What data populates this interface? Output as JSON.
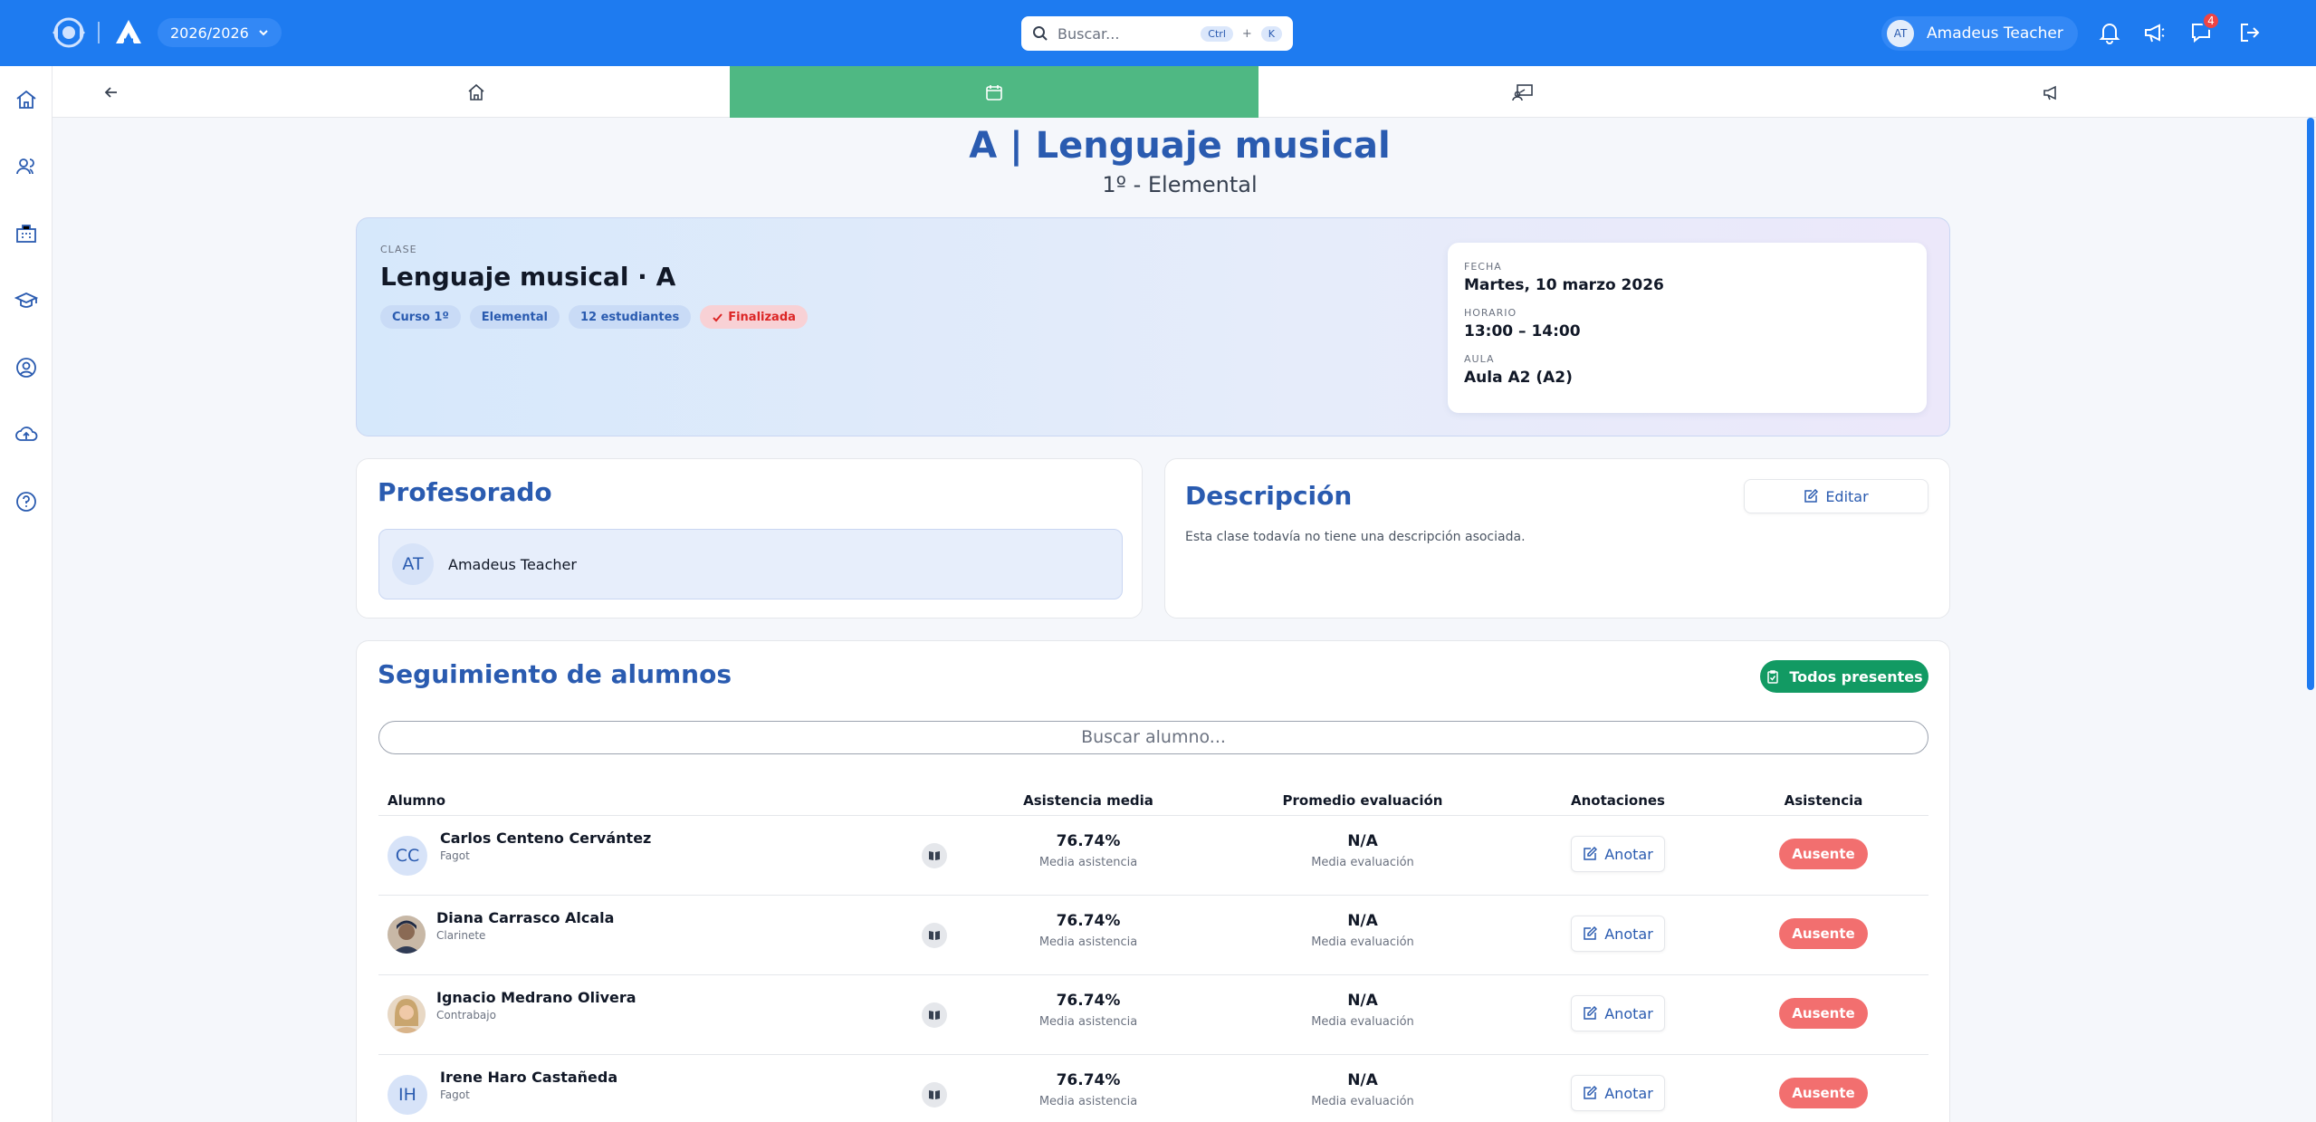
{
  "topbar": {
    "year": "2026/2026",
    "search_placeholder": "Buscar...",
    "kbd_ctrl": "Ctrl",
    "kbd_plus": "+",
    "kbd_k": "K",
    "user_initials": "AT",
    "user_name": "Amadeus Teacher",
    "messages_count": "4",
    "accent": "#1e7bf0"
  },
  "sidebar": {
    "items": [
      "home-icon",
      "users-icon",
      "building-icon",
      "graduation-cap-icon",
      "user-circle-icon",
      "cloud-upload-icon",
      "help-circle-icon"
    ]
  },
  "tabs": [
    "back-arrow-icon",
    "home-icon",
    "calendar-icon",
    "classroom-teacher-icon",
    "megaphone-icon"
  ],
  "header": {
    "title": "A | Lenguaje musical",
    "subtitle": "1º - Elemental"
  },
  "class_card": {
    "label": "CLASE",
    "name": "Lenguaje musical · A",
    "chips": [
      "Curso 1º",
      "Elemental",
      "12 estudiantes"
    ],
    "status": "Finalizada",
    "date_label": "FECHA",
    "date": "Martes, 10 marzo 2026",
    "time_label": "HORARIO",
    "time": "13:00 – 14:00",
    "room_label": "AULA",
    "room": "Aula A2 (A2)"
  },
  "teachers": {
    "title": "Profesorado",
    "items": [
      {
        "initials": "AT",
        "name": "Amadeus Teacher"
      }
    ]
  },
  "description": {
    "title": "Descripción",
    "edit_label": "Editar",
    "text": "Esta clase todavía no tiene una descripción asociada."
  },
  "students": {
    "title": "Seguimiento de alumnos",
    "all_present_label": "Todos presentes",
    "search_placeholder": "Buscar alumno...",
    "columns": [
      "Alumno",
      "Asistencia media",
      "Promedio evaluación",
      "Anotaciones",
      "Asistencia"
    ],
    "rows": [
      {
        "initials": "CC",
        "name": "Carlos Centeno Cervántez",
        "instrument": "Fagot",
        "attendance": "76.74%",
        "attendance_sub": "Media asistencia",
        "grade": "N/A",
        "grade_sub": "Media evaluación",
        "note_label": "Anotar",
        "status": "Ausente"
      },
      {
        "initials": "",
        "name": "Diana Carrasco Alcala",
        "instrument": "Clarinete",
        "attendance": "76.74%",
        "attendance_sub": "Media asistencia",
        "grade": "N/A",
        "grade_sub": "Media evaluación",
        "note_label": "Anotar",
        "status": "Ausente"
      },
      {
        "initials": "",
        "name": "Ignacio Medrano Olivera",
        "instrument": "Contrabajo",
        "attendance": "76.74%",
        "attendance_sub": "Media asistencia",
        "grade": "N/A",
        "grade_sub": "Media evaluación",
        "note_label": "Anotar",
        "status": "Ausente"
      },
      {
        "initials": "IH",
        "name": "Irene Haro Castañeda",
        "instrument": "Fagot",
        "attendance": "76.74%",
        "attendance_sub": "Media asistencia",
        "grade": "N/A",
        "grade_sub": "Media evaluación",
        "note_label": "Anotar",
        "status": "Ausente"
      }
    ]
  }
}
